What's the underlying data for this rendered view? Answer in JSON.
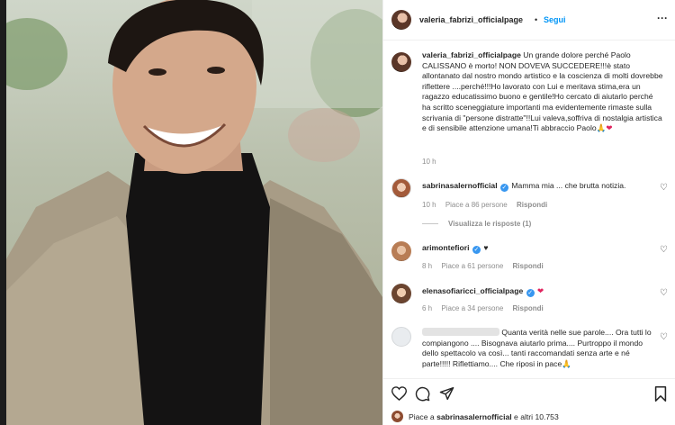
{
  "header": {
    "username": "valeria_fabrizi_officialpage",
    "separator": "•",
    "follow_label": "Segui",
    "more_label": "···"
  },
  "caption": {
    "username": "valeria_fabrizi_officialpage",
    "text": "Un grande dolore perché Paolo CALISSANO è morto! NON DOVEVA SUCCEDERE!!!è stato allontanato dal nostro mondo artistico e la coscienza di molti dovrebbe riflettere ....perché!!!Ho lavorato con Lui e meritava stima,era un ragazzo educatissimo buono e gentile!Ho cercato di aiutarlo perché ha scritto sceneggiature importanti ma evidentemente rimaste sulla scrivania di \"persone distratte\"!!Lui valeva,soffriva di nostalgia artistica e di sensibile attenzione umana!Ti abbraccio Paolo",
    "emoji": "🙏",
    "heart": "❤",
    "time": "10 h"
  },
  "comments": [
    {
      "username": "sabrinasalernofficial",
      "verified": true,
      "text": "Mamma mia ... che brutta notizia.",
      "time": "10 h",
      "likes": "Piace a 86 persone",
      "reply_label": "Rispondi",
      "view_replies": "Visualizza le risposte (1)"
    },
    {
      "username": "arimontefiori",
      "verified": true,
      "text": "♥",
      "time": "8 h",
      "likes": "Piace a 61 persone",
      "reply_label": "Rispondi"
    },
    {
      "username": "elenasofiaricci_officialpage",
      "verified": true,
      "text": "❤",
      "time": "6 h",
      "likes": "Piace a 34 persone",
      "reply_label": "Rispondi"
    },
    {
      "username": "",
      "verified": false,
      "text": "Quanta verità nelle sue parole.... Ora tutti lo compiangono .... Bisognava aiutarlo prima.... Purtroppo il mondo dello spettacolo va così... tanti raccomandati senza arte e né parte!!!!! Riflettiamo.... Che riposi in pace",
      "emoji": "🙏"
    }
  ],
  "footer": {
    "likes_prefix": "Piace a",
    "likes_user": "sabrinasalernofficial",
    "likes_suffix": "e altri 10.753"
  },
  "icons": [
    "heart-icon",
    "comment-icon",
    "share-icon",
    "bookmark-icon",
    "more-icon",
    "verified-badge-icon",
    "prayer-hands-icon"
  ]
}
